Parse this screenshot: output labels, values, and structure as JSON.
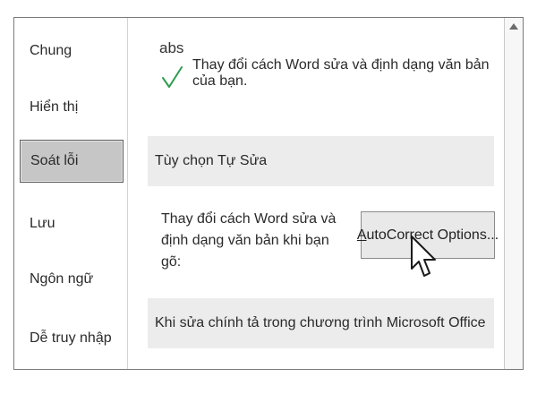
{
  "sidebar": {
    "items": [
      {
        "label": "Chung",
        "selected": false
      },
      {
        "label": "Hiển thị",
        "selected": false
      },
      {
        "label": "Soát lỗi",
        "selected": true
      },
      {
        "label": "Lưu",
        "selected": false
      },
      {
        "label": "Ngôn ngữ",
        "selected": false
      },
      {
        "label": "Dễ truy nhập",
        "selected": false
      }
    ]
  },
  "header": {
    "icon_text": "abs",
    "icon": "abs-checkmark-icon",
    "text": "Thay đổi cách Word sửa và định dạng văn bản của bạn."
  },
  "autocorrect_section": {
    "title": "Tùy chọn Tự Sửa",
    "description": "Thay đổi cách Word sửa và định dạng văn bản khi bạn gõ:",
    "button_accel": "A",
    "button_rest": "utoCorrect Options..."
  },
  "spelling_section": {
    "title": "Khi sửa chính tả trong chương trình Microsoft Office"
  },
  "colors": {
    "checkmark": "#2e9b4e",
    "selected_bg": "#c6c6c6",
    "band_bg": "#ececec"
  }
}
